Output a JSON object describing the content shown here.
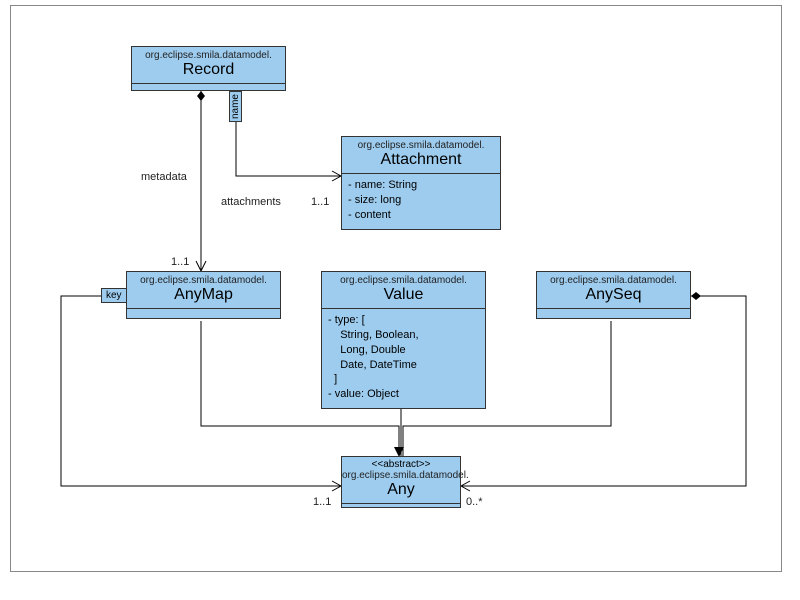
{
  "diagram": {
    "package": "org.eclipse.smila.datamodel.",
    "classes": {
      "record": {
        "name": "Record"
      },
      "attachment": {
        "name": "Attachment",
        "attrs": [
          "- name: String",
          "- size: long",
          "- content"
        ]
      },
      "anymap": {
        "name": "AnyMap"
      },
      "value": {
        "name": "Value",
        "attrs": [
          "- type: [",
          "    String, Boolean,",
          "    Long, Double",
          "    Date, DateTime",
          "  ]",
          "- value: Object"
        ]
      },
      "anyseq": {
        "name": "AnySeq"
      },
      "any": {
        "stereo": "<<abstract>>",
        "name": "Any"
      }
    },
    "labels": {
      "metadata": "metadata",
      "attachments": "attachments",
      "m11a": "1..1",
      "m11b": "1..1",
      "m11c": "1..1",
      "m0s": "0..*",
      "key": "key",
      "name": "name"
    }
  }
}
